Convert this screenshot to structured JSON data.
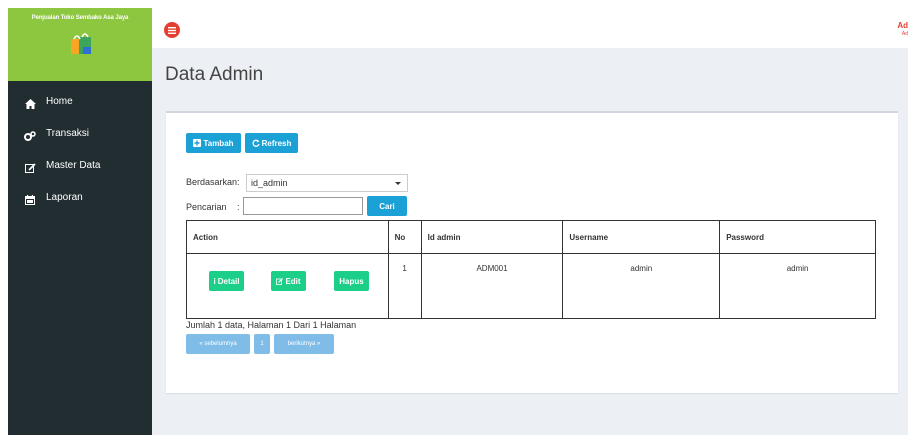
{
  "sidebar": {
    "brand_title": "Penjualan Toko Sembako Asa Jaya",
    "items": [
      {
        "label": "Home",
        "icon": "home-icon"
      },
      {
        "label": "Transaksi",
        "icon": "gears-icon"
      },
      {
        "label": "Master Data",
        "icon": "edit-icon"
      },
      {
        "label": "Laporan",
        "icon": "calendar-icon"
      }
    ]
  },
  "header": {
    "user_name": "Ad",
    "user_role": "Ad"
  },
  "page": {
    "title": "Data Admin"
  },
  "toolbar": {
    "tambah_label": "Tambah",
    "refresh_label": "Refresh"
  },
  "filter": {
    "berdasarkan_label": "Berdasarkan:",
    "select_value": "id_admin",
    "pencarian_label": "Pencarian",
    "pencarian_colon": ":",
    "search_value": "",
    "cari_label": "Cari"
  },
  "table": {
    "headers": [
      "Action",
      "No",
      "Id admin",
      "Username",
      "Password"
    ],
    "rows": [
      {
        "detail_label": "Detail",
        "edit_label": "Edit",
        "hapus_label": "Hapus",
        "no": "1",
        "id_admin": "ADM001",
        "username": "admin",
        "password": "admin"
      }
    ]
  },
  "pagination": {
    "info": "Jumlah 1 data, Halaman 1 Dari 1 Halaman",
    "prev_label": "« sebelumnya",
    "page_label": "1",
    "next_label": "berikutnya »"
  },
  "colors": {
    "brand": "#8dc63f",
    "sidebar": "#222d32",
    "primary": "#1ba1d6",
    "success": "#1ccf89",
    "danger": "#e33e31"
  }
}
